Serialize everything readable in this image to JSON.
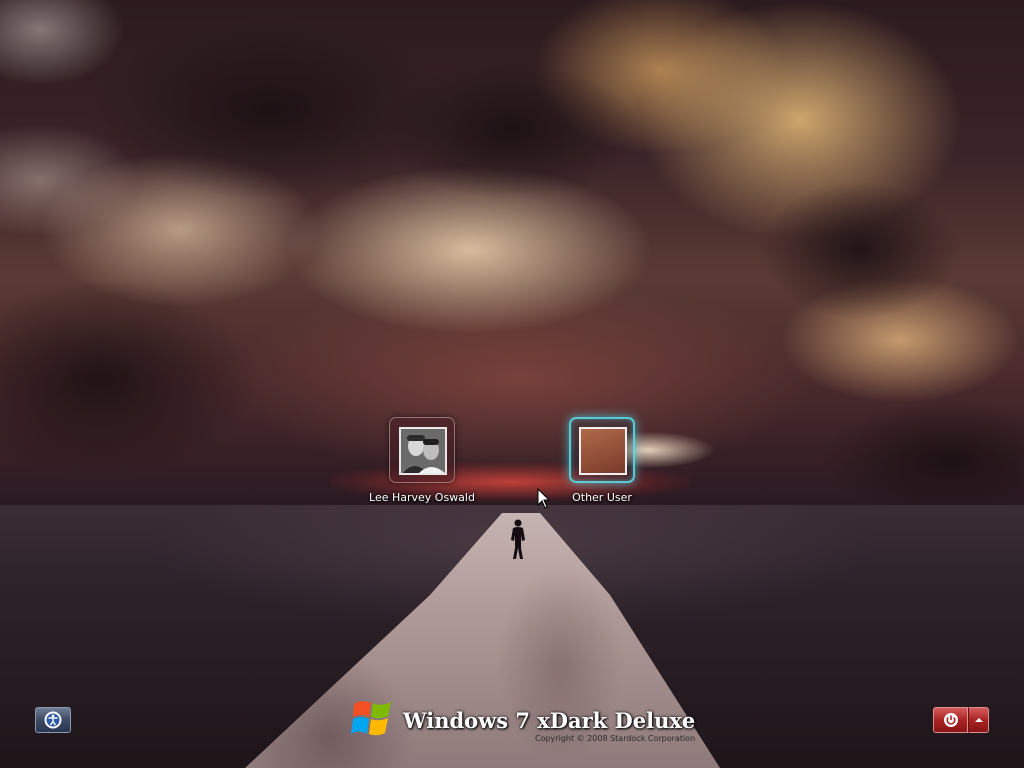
{
  "login_screen": {
    "users": [
      {
        "name": "Lee Harvey Oswald",
        "state": "active",
        "picture": "user-portrait"
      },
      {
        "name": "Other User",
        "state": "hover",
        "picture": "blank"
      }
    ]
  },
  "bottom_bar": {
    "ease_of_access_icon": "ease-of-access-icon",
    "power_icon": "power-icon",
    "power_options_icon": "chevron-up-icon",
    "brand": {
      "logo": "windows-flag-logo",
      "name": "Windows 7 xDark Deluxe",
      "copyright": "Copyright © 2008 Stardock Corporation"
    }
  },
  "colors": {
    "hover_glow": "#5adce6",
    "power_red": "#a82424",
    "ease_blue": "#3c4a62"
  }
}
